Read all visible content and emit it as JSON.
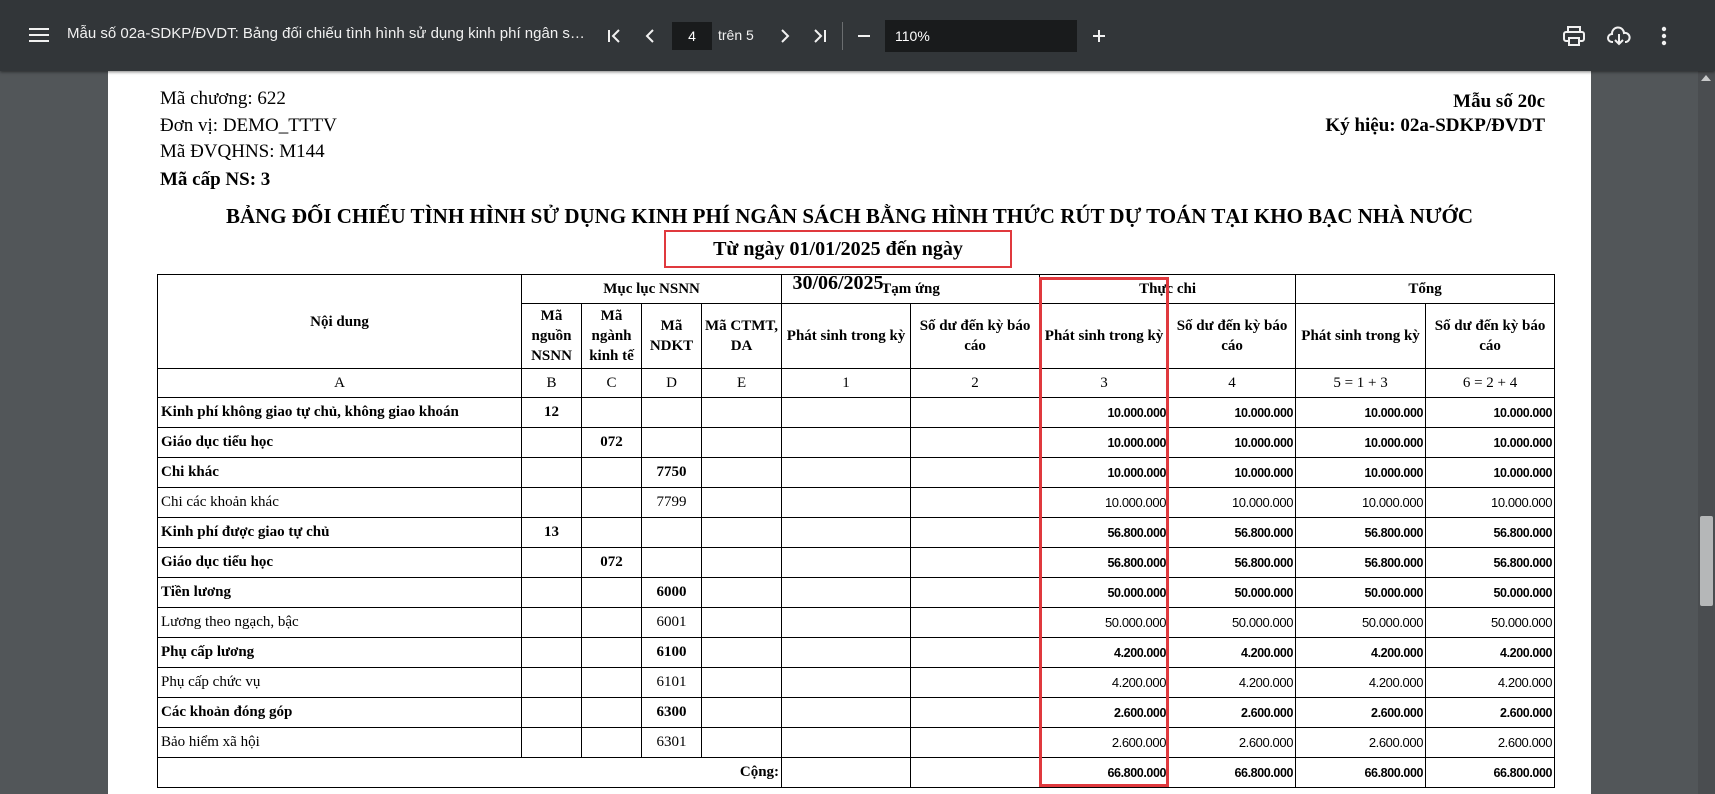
{
  "toolbar": {
    "menu_icon": "menu-icon",
    "title": "Mẫu số 02a-SDKP/ĐVDT: Bảng đối chiếu tình hình sử dụng kinh phí ngân sác...",
    "page_current": "4",
    "page_of": "trên 5",
    "zoom": "110%",
    "icons": [
      "first-page-icon",
      "prev-page-icon",
      "next-page-icon",
      "last-page-icon",
      "zoom-out-icon",
      "zoom-in-icon",
      "print-icon",
      "download-icon",
      "more-icon"
    ]
  },
  "doc": {
    "ma_chuong": "Mã chương: 622",
    "don_vi": "Đơn vị: DEMO_TTTV",
    "ma_dvqhns": "Mã ĐVQHNS: M144",
    "ma_cap_ns": "Mã cấp NS: 3",
    "mau_so": "Mẫu số 20c",
    "ky_hieu": "Ký hiệu: 02a-SDKP/ĐVDT",
    "title": "BẢNG ĐỐI CHIẾU TÌNH HÌNH SỬ DỤNG KINH PHÍ NGÂN SÁCH BẰNG HÌNH THỨC RÚT DỰ TOÁN TẠI KHO BẠC NHÀ NƯỚC",
    "date_range": "Từ ngày 01/01/2025 đến ngày 30/06/2025"
  },
  "table": {
    "h_noi_dung": "Nội dung",
    "h_muc_luc": "Mục lục NSNN",
    "h_tam_ung": "Tạm ứng",
    "h_thuc_chi": "Thực chi",
    "h_tong": "Tổng",
    "h_ma_nguon": "Mã nguồn NSNN",
    "h_ma_nganh": "Mã ngành kinh tế",
    "h_ma_ndkt": "Mã NDKT",
    "h_ma_ctmt": "Mã CTMT, DA",
    "h_phat_sinh": "Phát sinh trong kỳ",
    "h_so_du": "Số dư đến kỳ báo cáo",
    "codes": [
      "A",
      "B",
      "C",
      "D",
      "E",
      "1",
      "2",
      "3",
      "4",
      "5 = 1 + 3",
      "6 = 2 + 4"
    ],
    "rows": [
      {
        "label": "Kinh phí không giao tự chủ, không giao khoán",
        "b": "12",
        "c": "",
        "d": "",
        "v3": "10.000.000",
        "v4": "10.000.000",
        "v5": "10.000.000",
        "v6": "10.000.000",
        "bold": true
      },
      {
        "label": "Giáo dục tiểu học",
        "b": "",
        "c": "072",
        "d": "",
        "v3": "10.000.000",
        "v4": "10.000.000",
        "v5": "10.000.000",
        "v6": "10.000.000",
        "bold": true
      },
      {
        "label": "Chi khác",
        "b": "",
        "c": "",
        "d": "7750",
        "v3": "10.000.000",
        "v4": "10.000.000",
        "v5": "10.000.000",
        "v6": "10.000.000",
        "bold": true
      },
      {
        "label": "Chi các khoản khác",
        "b": "",
        "c": "",
        "d": "7799",
        "v3": "10.000.000",
        "v4": "10.000.000",
        "v5": "10.000.000",
        "v6": "10.000.000",
        "bold": false
      },
      {
        "label": "Kinh phí được giao tự chủ",
        "b": "13",
        "c": "",
        "d": "",
        "v3": "56.800.000",
        "v4": "56.800.000",
        "v5": "56.800.000",
        "v6": "56.800.000",
        "bold": true
      },
      {
        "label": "Giáo dục tiểu học",
        "b": "",
        "c": "072",
        "d": "",
        "v3": "56.800.000",
        "v4": "56.800.000",
        "v5": "56.800.000",
        "v6": "56.800.000",
        "bold": true
      },
      {
        "label": "Tiền lương",
        "b": "",
        "c": "",
        "d": "6000",
        "v3": "50.000.000",
        "v4": "50.000.000",
        "v5": "50.000.000",
        "v6": "50.000.000",
        "bold": true
      },
      {
        "label": "Lương theo ngạch, bậc",
        "b": "",
        "c": "",
        "d": "6001",
        "v3": "50.000.000",
        "v4": "50.000.000",
        "v5": "50.000.000",
        "v6": "50.000.000",
        "bold": false
      },
      {
        "label": "Phụ cấp lương",
        "b": "",
        "c": "",
        "d": "6100",
        "v3": "4.200.000",
        "v4": "4.200.000",
        "v5": "4.200.000",
        "v6": "4.200.000",
        "bold": true
      },
      {
        "label": "Phụ cấp chức vụ",
        "b": "",
        "c": "",
        "d": "6101",
        "v3": "4.200.000",
        "v4": "4.200.000",
        "v5": "4.200.000",
        "v6": "4.200.000",
        "bold": false
      },
      {
        "label": "Các khoản đóng góp",
        "b": "",
        "c": "",
        "d": "6300",
        "v3": "2.600.000",
        "v4": "2.600.000",
        "v5": "2.600.000",
        "v6": "2.600.000",
        "bold": true
      },
      {
        "label": "Bảo hiểm xã hội",
        "b": "",
        "c": "",
        "d": "6301",
        "v3": "2.600.000",
        "v4": "2.600.000",
        "v5": "2.600.000",
        "v6": "2.600.000",
        "bold": false
      }
    ],
    "total": {
      "label": "Cộng:",
      "v3": "66.800.000",
      "v4": "66.800.000",
      "v5": "66.800.000",
      "v6": "66.800.000"
    }
  },
  "colors": {
    "toolbar": "#323639",
    "viewer_bg": "#525659",
    "highlight": "#e0393e"
  }
}
